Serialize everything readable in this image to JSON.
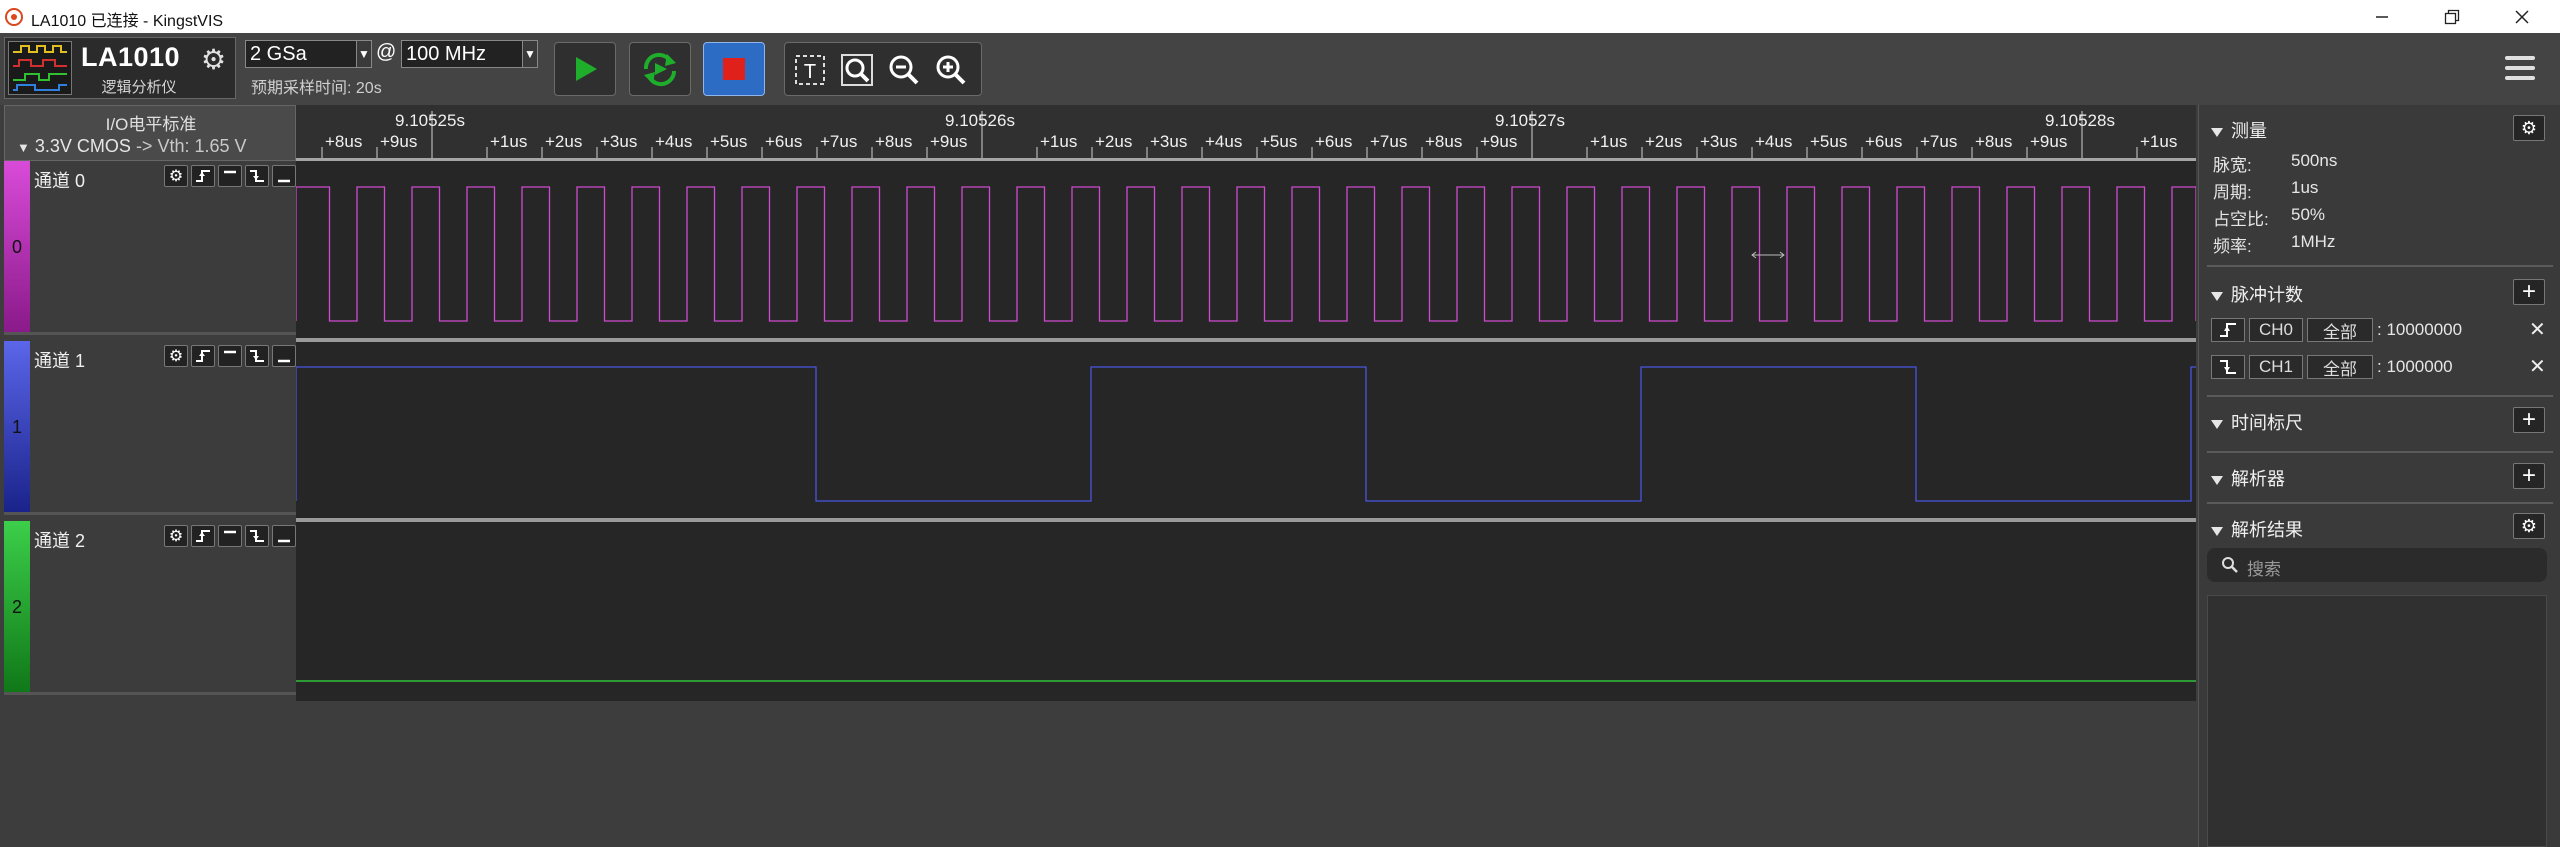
{
  "window": {
    "title": "LA1010 已连接 - KingstVIS",
    "controls": [
      "minimize-icon",
      "restore-icon",
      "close-icon"
    ]
  },
  "toolbar": {
    "device_name": "LA1010",
    "device_subtitle": "逻辑分析仪",
    "sample_count": "2 GSa",
    "at_symbol": "@",
    "sample_rate": "100 MHz",
    "expected_time": "预期采样时间: 20s",
    "run_icon": "play-icon",
    "loop_icon": "loop-run-icon",
    "stop_icon": "stop-icon",
    "tools": [
      "text-cursor-icon",
      "zoom-fit-icon",
      "zoom-out-icon",
      "zoom-in-icon"
    ],
    "colors": {
      "run": "#1fae2c",
      "stop": "#e0201a",
      "active": "#2d6cc4"
    }
  },
  "io_standard": {
    "title": "I/O电平标准",
    "value": "3.3V CMOS",
    "vth": "-> Vth: 1.65 V"
  },
  "ruler": {
    "labels": [
      "+8us",
      "+9us",
      "9.10525s",
      "+1us",
      "+2us",
      "+3us",
      "+4us",
      "+5us",
      "+6us",
      "+7us",
      "+8us",
      "+9us",
      "9.10526s",
      "+1us",
      "+2us",
      "+3us",
      "+4us",
      "+5us",
      "+6us",
      "+7us",
      "+8us",
      "+9us",
      "9.10527s",
      "+1us",
      "+2us",
      "+3us",
      "+4us",
      "+5us",
      "+6us",
      "+7us",
      "+8us",
      "+9us",
      "9.10528s",
      "+1us"
    ]
  },
  "channels": [
    {
      "name": "通道 0",
      "index": "0",
      "color": "#c83cc8",
      "wave_color": "#d04ad0",
      "signal": "1MHz square, 50% duty"
    },
    {
      "name": "通道 1",
      "index": "1",
      "color": "#3a44d6",
      "wave_color": "#4a55e0",
      "signal": "100kHz square"
    },
    {
      "name": "通道 2",
      "index": "2",
      "color": "#28b038",
      "wave_color": "#2fbf3a",
      "signal": "constant low"
    }
  ],
  "right_panel": {
    "measure": {
      "title": "测量",
      "items": [
        {
          "label": "脉宽:",
          "value": "500ns"
        },
        {
          "label": "周期:",
          "value": "1us"
        },
        {
          "label": "占空比:",
          "value": "50%"
        },
        {
          "label": "频率:",
          "value": "1MHz"
        }
      ]
    },
    "pulse_count": {
      "title": "脉冲计数",
      "rows": [
        {
          "channel": "CH0",
          "range": "全部",
          "value": ": 10000000"
        },
        {
          "channel": "CH1",
          "range": "全部",
          "value": ": 1000000"
        }
      ]
    },
    "timing_ruler": {
      "title": "时间标尺"
    },
    "decoder": {
      "title": "解析器"
    },
    "decode_results": {
      "title": "解析结果",
      "search_placeholder": "搜索"
    }
  }
}
